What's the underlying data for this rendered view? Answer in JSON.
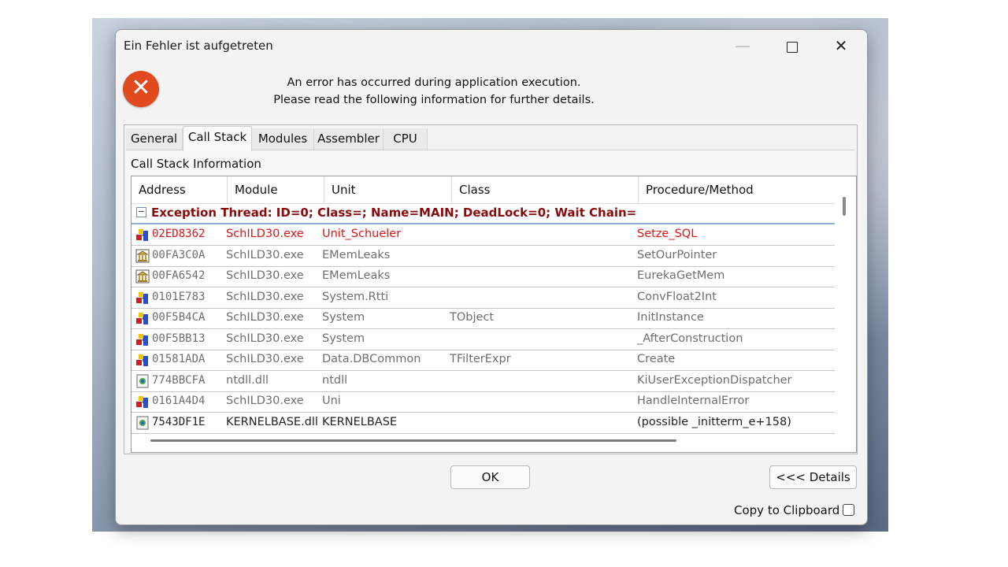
{
  "window": {
    "title": "Ein Fehler ist aufgetreten",
    "minimize_glyph": "—",
    "close_glyph": "✕"
  },
  "message": {
    "line1": "An error has occurred during application execution.",
    "line2": "Please read the following information for further details.",
    "icon_glyph": "✕"
  },
  "tabs": [
    {
      "label": "General"
    },
    {
      "label": "Call Stack",
      "active": true
    },
    {
      "label": "Modules"
    },
    {
      "label": "Assembler"
    },
    {
      "label": "CPU"
    }
  ],
  "section_label": "Call Stack Information",
  "columns": [
    "Address",
    "Module",
    "Unit",
    "Class",
    "Procedure/Method"
  ],
  "group": {
    "toggle": "−",
    "text": "Exception Thread: ID=0; Class=; Name=MAIN; DeadLock=0; Wait Chain="
  },
  "rows": [
    {
      "icon": "delphi-unit-icon",
      "address": "02ED8362",
      "module": "SchILD30.exe",
      "unit": "Unit_Schueler",
      "class": "",
      "method": "Setze_SQL",
      "style": "red"
    },
    {
      "icon": "library-icon",
      "address": "00FA3C0A",
      "module": "SchILD30.exe",
      "unit": "EMemLeaks",
      "class": "",
      "method": "SetOurPointer",
      "style": "gray"
    },
    {
      "icon": "library-icon",
      "address": "00FA6542",
      "module": "SchILD30.exe",
      "unit": "EMemLeaks",
      "class": "",
      "method": "EurekaGetMem",
      "style": "gray"
    },
    {
      "icon": "delphi-unit-icon",
      "address": "0101E783",
      "module": "SchILD30.exe",
      "unit": "System.Rtti",
      "class": "",
      "method": "ConvFloat2Int",
      "style": "gray"
    },
    {
      "icon": "delphi-unit-icon",
      "address": "00F5B4CA",
      "module": "SchILD30.exe",
      "unit": "System",
      "class": "TObject",
      "method": "InitInstance",
      "style": "gray"
    },
    {
      "icon": "delphi-unit-icon",
      "address": "00F5BB13",
      "module": "SchILD30.exe",
      "unit": "System",
      "class": "",
      "method": "_AfterConstruction",
      "style": "gray"
    },
    {
      "icon": "delphi-unit-icon",
      "address": "01581ADA",
      "module": "SchILD30.exe",
      "unit": "Data.DBCommon",
      "class": "TFilterExpr",
      "method": "Create",
      "style": "gray"
    },
    {
      "icon": "dll-icon",
      "address": "774BBCFA",
      "module": "ntdll.dll",
      "unit": "ntdll",
      "class": "",
      "method": "KiUserExceptionDispatcher",
      "style": "gray"
    },
    {
      "icon": "delphi-unit-icon",
      "address": "0161A4D4",
      "module": "SchILD30.exe",
      "unit": "Uni",
      "class": "",
      "method": "HandleInternalError",
      "style": "gray"
    },
    {
      "icon": "dll-icon",
      "address": "7543DF1E",
      "module": "KERNELBASE.dll",
      "unit": "KERNELBASE",
      "class": "",
      "method": "(possible _initterm_e+158)",
      "style": "dark"
    }
  ],
  "buttons": {
    "ok": "OK",
    "details": "<<< Details"
  },
  "clipboard_label": "Copy to Clipboard",
  "clipboard_checked": false
}
